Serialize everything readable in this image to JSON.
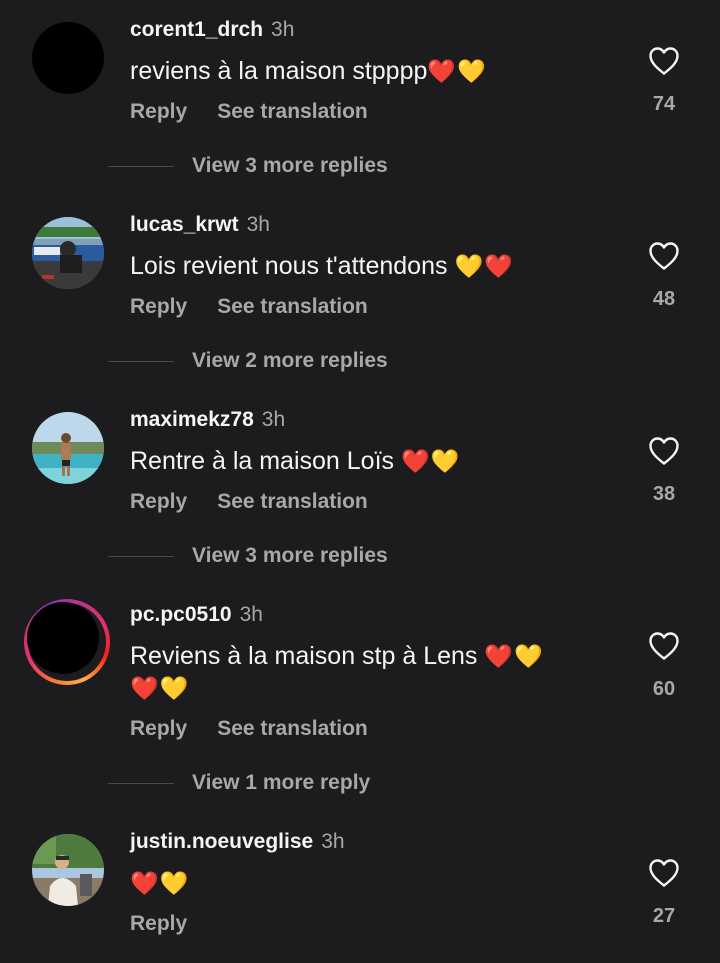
{
  "comments": [
    {
      "username": "corent1_drch",
      "time": "3h",
      "text": "reviens à la maison stpppp",
      "emoji": "❤️💛",
      "reply_label": "Reply",
      "translate_label": "See translation",
      "likes": "74",
      "view_more": "View 3 more replies"
    },
    {
      "username": "lucas_krwt",
      "time": "3h",
      "text": "Lois revient nous t'attendons",
      "emoji": "💛❤️",
      "reply_label": "Reply",
      "translate_label": "See translation",
      "likes": "48",
      "view_more": "View 2 more replies"
    },
    {
      "username": "maximekz78",
      "time": "3h",
      "text": "Rentre à la maison Loïs",
      "emoji": "❤️💛",
      "reply_label": "Reply",
      "translate_label": "See translation",
      "likes": "38",
      "view_more": "View 3 more replies"
    },
    {
      "username": "pc.pc0510",
      "time": "3h",
      "text": "Reviens à la maison stp à Lens",
      "emoji": "❤️💛",
      "emoji_line2": "❤️💛",
      "reply_label": "Reply",
      "translate_label": "See translation",
      "likes": "60",
      "view_more": "View 1 more reply"
    },
    {
      "username": "justin.noeuveglise",
      "time": "3h",
      "emoji": "❤️💛",
      "reply_label": "Reply",
      "likes": "27"
    }
  ],
  "icons": {
    "like": "heart-outline-icon"
  },
  "colors": {
    "background": "#1c1c1e",
    "text_primary": "#f5f5f5",
    "text_secondary": "#a8a8a8"
  }
}
